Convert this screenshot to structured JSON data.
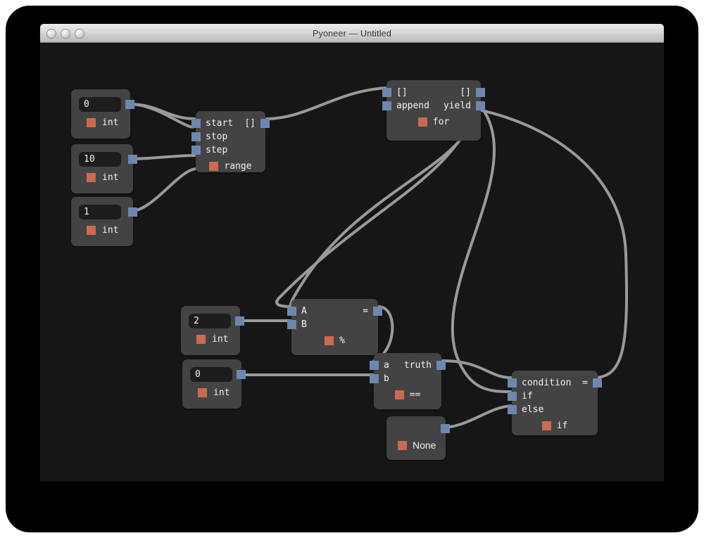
{
  "window": {
    "title": "Pyoneer — Untitled",
    "buttons": [
      {
        "name": "close-button",
        "label": "close"
      },
      {
        "name": "minimize-button",
        "label": "minimize"
      },
      {
        "name": "zoom-button",
        "label": "zoom"
      }
    ]
  },
  "colors": {
    "canvas_bg": "#161616",
    "node_bg": "#434343",
    "port_blue": "#6d87b0",
    "type_orange": "#cb6a50",
    "wire": "#9a9a9a",
    "text": "#f2f2f2",
    "field_bg": "#1d1d1d"
  },
  "nodes": {
    "int_0": {
      "type": "int",
      "value": "0",
      "outputs": [
        ""
      ]
    },
    "int_10": {
      "type": "int",
      "value": "10",
      "outputs": [
        ""
      ]
    },
    "int_1": {
      "type": "int",
      "value": "1",
      "outputs": [
        ""
      ]
    },
    "int_2": {
      "type": "int",
      "value": "2",
      "outputs": [
        ""
      ]
    },
    "int_0b": {
      "type": "int",
      "value": "0",
      "outputs": [
        ""
      ]
    },
    "range": {
      "title": "range",
      "inputs": [
        "start",
        "stop",
        "step"
      ],
      "outputs": [
        "[]"
      ]
    },
    "for": {
      "title": "for",
      "inputs": [
        "[]",
        "append"
      ],
      "outputs": [
        "[]",
        "yield"
      ]
    },
    "modulo": {
      "title": "%",
      "inputs": [
        "A",
        "B"
      ],
      "outputs": [
        "="
      ]
    },
    "equals": {
      "title": "==",
      "inputs": [
        "a",
        "b"
      ],
      "outputs": [
        "truth"
      ]
    },
    "if": {
      "title": "if",
      "inputs": [
        "condition",
        "if",
        "else"
      ],
      "outputs": [
        "="
      ]
    },
    "none": {
      "title": "None",
      "inputs": [],
      "outputs": [
        ""
      ]
    }
  },
  "connections": [
    {
      "from": "int_0",
      "from_port": "out",
      "to": "range",
      "to_port": "start"
    },
    {
      "from": "int_10",
      "from_port": "out",
      "to": "range",
      "to_port": "stop"
    },
    {
      "from": "int_1",
      "from_port": "out",
      "to": "range",
      "to_port": "step"
    },
    {
      "from": "range",
      "from_port": "[]",
      "to": "for",
      "to_port": "[]"
    },
    {
      "from": "if",
      "from_port": "=",
      "to": "for",
      "to_port": "append"
    },
    {
      "from": "for",
      "from_port": "yield",
      "to": "modulo",
      "to_port": "A"
    },
    {
      "from": "int_2",
      "from_port": "out",
      "to": "modulo",
      "to_port": "B"
    },
    {
      "from": "modulo",
      "from_port": "=",
      "to": "equals",
      "to_port": "a"
    },
    {
      "from": "int_0b",
      "from_port": "out",
      "to": "equals",
      "to_port": "b"
    },
    {
      "from": "equals",
      "from_port": "truth",
      "to": "if",
      "to_port": "condition"
    },
    {
      "from": "for",
      "from_port": "yield",
      "to": "if",
      "to_port": "if"
    },
    {
      "from": "none",
      "from_port": "out",
      "to": "if",
      "to_port": "else"
    }
  ]
}
